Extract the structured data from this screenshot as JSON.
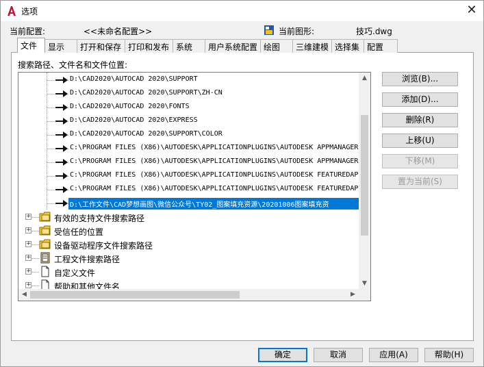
{
  "window": {
    "title": "选项",
    "close_glyph": "✕"
  },
  "header": {
    "current_profile_label": "当前配置:",
    "current_profile_value": "<<未命名配置>>",
    "current_drawing_label": "当前图形:",
    "current_drawing_value": "技巧.dwg"
  },
  "tabs": [
    {
      "label": "文件",
      "active": true
    },
    {
      "label": "显示"
    },
    {
      "label": "打开和保存"
    },
    {
      "label": "打印和发布"
    },
    {
      "label": "系统"
    },
    {
      "label": "用户系统配置"
    },
    {
      "label": "绘图"
    },
    {
      "label": "三维建模"
    },
    {
      "label": "选择集"
    },
    {
      "label": "配置"
    }
  ],
  "files": {
    "section_label": "搜索路径、文件名和文件位置:",
    "paths": [
      "D:\\CAD2020\\AUTOCAD 2020\\SUPPORT",
      "D:\\CAD2020\\AUTOCAD 2020\\SUPPORT\\ZH-CN",
      "D:\\CAD2020\\AUTOCAD 2020\\FONTS",
      "D:\\CAD2020\\AUTOCAD 2020\\EXPRESS",
      "D:\\CAD2020\\AUTOCAD 2020\\SUPPORT\\COLOR",
      "C:\\PROGRAM FILES (X86)\\AUTODESK\\APPLICATIONPLUGINS\\AUTODESK APPMANAGER",
      "C:\\PROGRAM FILES (X86)\\AUTODESK\\APPLICATIONPLUGINS\\AUTODESK APPMANAGER",
      "C:\\PROGRAM FILES (X86)\\AUTODESK\\APPLICATIONPLUGINS\\AUTODESK FEATUREDAP",
      "C:\\PROGRAM FILES (X86)\\AUTODESK\\APPLICATIONPLUGINS\\AUTODESK FEATUREDAP",
      "D:\\工作文件\\CAD梦想画图\\微信公众号\\TY02_图案填充资源\\20201006图案填充资"
    ],
    "selected_index": 9,
    "nodes": [
      {
        "label": "有效的支持文件搜索路径",
        "icon": "folder-icon"
      },
      {
        "label": "受信任的位置",
        "icon": "folder-icon"
      },
      {
        "label": "设备驱动程序文件搜索路径",
        "icon": "folder-icon"
      },
      {
        "label": "工程文件搜索路径",
        "icon": "project-icon"
      },
      {
        "label": "自定义文件",
        "icon": "document-icon"
      },
      {
        "label": "帮助和其他文件名",
        "icon": "document-icon"
      }
    ]
  },
  "side_buttons": {
    "browse": "浏览(B)...",
    "add": "添加(D)...",
    "remove": "删除(R)",
    "move_up": "上移(U)",
    "move_down": "下移(M)",
    "set_current": "置为当前(S)"
  },
  "footer": {
    "ok": "确定",
    "cancel": "取消",
    "apply": "应用(A)",
    "help": "帮助(H)"
  },
  "colors": {
    "selection": "#0078d7",
    "app_icon": "#c8102e"
  }
}
